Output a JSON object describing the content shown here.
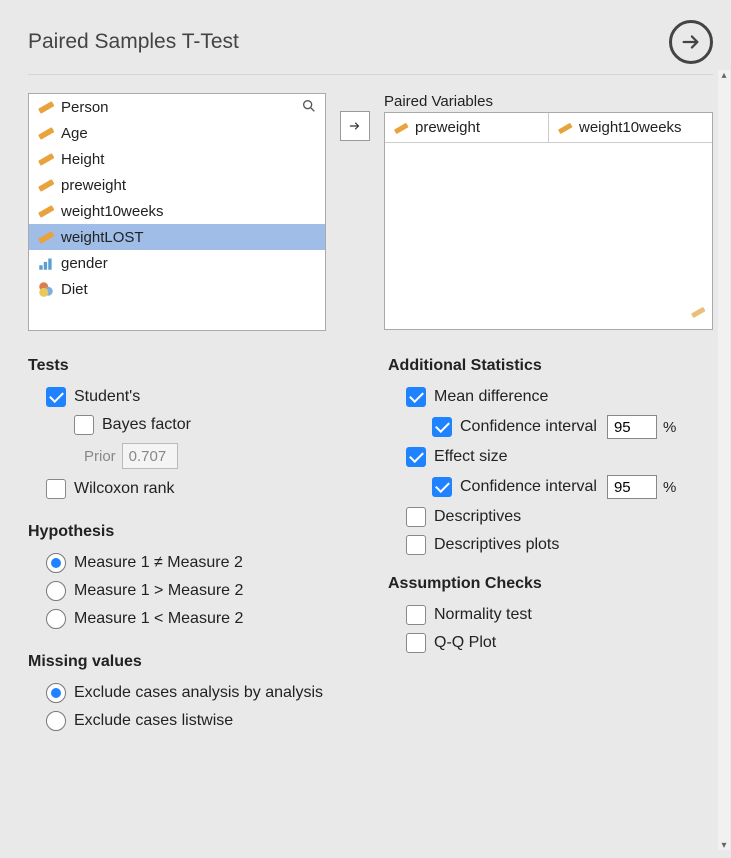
{
  "title": "Paired Samples T-Test",
  "variables": [
    {
      "name": "Person",
      "type": "scale"
    },
    {
      "name": "Age",
      "type": "scale"
    },
    {
      "name": "Height",
      "type": "scale"
    },
    {
      "name": "preweight",
      "type": "scale"
    },
    {
      "name": "weight10weeks",
      "type": "scale"
    },
    {
      "name": "weightLOST",
      "type": "scale",
      "selected": true
    },
    {
      "name": "gender",
      "type": "ordinal"
    },
    {
      "name": "Diet",
      "type": "nominal"
    }
  ],
  "paired": {
    "label": "Paired Variables",
    "pairs": [
      {
        "a": "preweight",
        "b": "weight10weeks"
      }
    ]
  },
  "sections": {
    "tests": "Tests",
    "hypothesis": "Hypothesis",
    "missing": "Missing values",
    "addstats": "Additional Statistics",
    "assump": "Assumption Checks"
  },
  "tests": {
    "students": {
      "label": "Student's",
      "checked": true
    },
    "bayes": {
      "label": "Bayes factor",
      "checked": false
    },
    "prior_label": "Prior",
    "prior_value": "0.707",
    "wilcoxon": {
      "label": "Wilcoxon rank",
      "checked": false
    }
  },
  "hypothesis": {
    "neq": {
      "label": "Measure 1 ≠ Measure 2",
      "checked": true
    },
    "gt": {
      "label": "Measure 1 > Measure 2",
      "checked": false
    },
    "lt": {
      "label": "Measure 1 < Measure 2",
      "checked": false
    }
  },
  "missing": {
    "analysis": {
      "label": "Exclude cases analysis by analysis",
      "checked": true
    },
    "listwise": {
      "label": "Exclude cases listwise",
      "checked": false
    }
  },
  "addstats": {
    "meandiff": {
      "label": "Mean difference",
      "checked": true
    },
    "meandiff_ci": {
      "label": "Confidence interval",
      "checked": true,
      "value": "95"
    },
    "effect": {
      "label": "Effect size",
      "checked": true
    },
    "effect_ci": {
      "label": "Confidence interval",
      "checked": true,
      "value": "95"
    },
    "desc": {
      "label": "Descriptives",
      "checked": false
    },
    "descplots": {
      "label": "Descriptives plots",
      "checked": false
    },
    "pct": "%"
  },
  "assump": {
    "norm": {
      "label": "Normality test",
      "checked": false
    },
    "qq": {
      "label": "Q-Q Plot",
      "checked": false
    }
  }
}
